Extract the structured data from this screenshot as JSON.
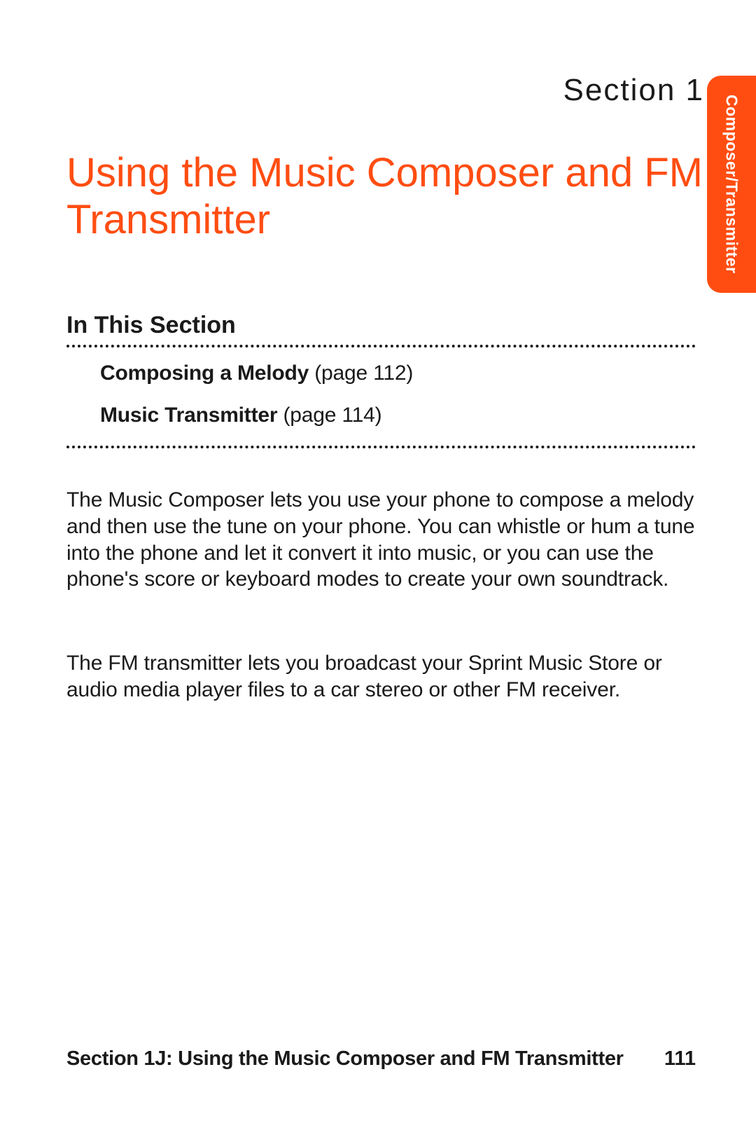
{
  "side_tab": "Composer/Transmitter",
  "section_label": "Section 1",
  "title": "Using the Music Composer and FM Transmitter",
  "in_this_section": {
    "heading": "In This Section",
    "items": [
      {
        "title": "Composing a Melody",
        "page": "(page 112)"
      },
      {
        "title": "Music Transmitter",
        "page": "(page 114)"
      }
    ]
  },
  "paragraphs": [
    "The Music Composer lets you use your phone to compose a melody and then use the tune on your phone. You can whistle or hum a tune into the phone and let it convert it into music, or you can use the phone's score or keyboard modes to create your own soundtrack.",
    "The FM transmitter lets you broadcast your Sprint Music Store or audio media player files to a car stereo or other FM receiver."
  ],
  "footer": {
    "text": "Section 1J: Using the Music Composer and FM Transmitter",
    "page_number": "111"
  }
}
